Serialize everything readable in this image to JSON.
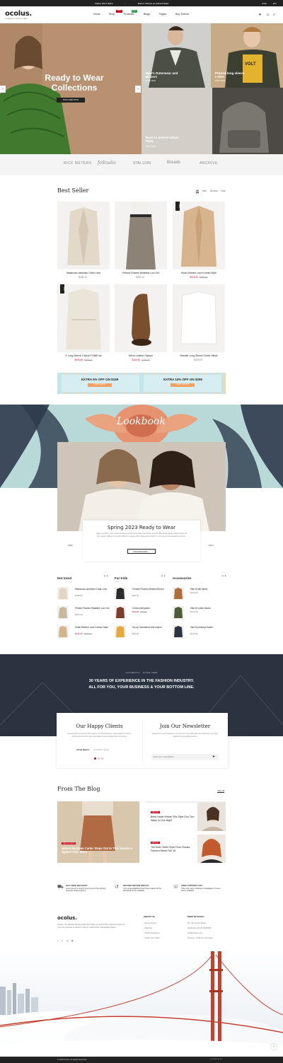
{
  "topbar": {
    "msg1": "FREE RETURNS",
    "msg2": "BEST PRICE GUARANTEED",
    "lang": "USD",
    "lang2": "EN"
  },
  "header": {
    "logo": "ocolus.",
    "tagline": "ECOMMERCE · SHOPIFY THEME",
    "nav": [
      "Home",
      "Shop",
      "Products",
      "Blogs",
      "Pages",
      "Buy Theme!"
    ],
    "badges": {
      "shop": "SALE",
      "products": "HOT"
    },
    "cart_count": "0"
  },
  "hero": {
    "title_line1": "Ready to Wear",
    "title_line2": "Collections",
    "cta": "DISCOVER NOW",
    "block_outerwear": "Men's Outerwear and Blazers",
    "block_outerwear_cta": "SHOP NOW",
    "block_tshirt": "Printed long sleeve t-shirt",
    "block_tshirt_cta": "SHOP NOW",
    "block_school": "Back to school Urban BGM",
    "block_school_cta": "SHOP NOW",
    "tshirt_print": "VOLT"
  },
  "brands": [
    "RICK METERS",
    "foStudio",
    "STAL LION",
    "Breads",
    "ARCHIVE"
  ],
  "best_seller": {
    "title": "Best Seller",
    "filters": [
      "All",
      "Men",
      "Women",
      "Kids"
    ],
    "products": [
      {
        "name": "Waistcoat Lambskin Collar Linin",
        "price": "$189.00",
        "old": "",
        "sale": false,
        "tag": ""
      },
      {
        "name": "Printed Flowers Waistline Low Girl",
        "price": "$254.10",
        "old": "",
        "sale": false,
        "tag": ""
      },
      {
        "name": "Khaki Women Lace Korean Style",
        "price": "$216.30",
        "old": "$199.40",
        "sale": true,
        "tag": "NEW"
      },
      {
        "name": "4' Long Sleeve V-Neck PL688 Hot",
        "price": "$205.45",
        "old": "$199.40",
        "sale": true,
        "tag": "NEW"
      },
      {
        "name": "Men's Leather Olympo",
        "price": "$120.30",
        "old": "$199.40",
        "sale": true,
        "tag": ""
      },
      {
        "name": "Sweater Long Sleeve Gothic Hthyle",
        "price": "$215.00",
        "old": "",
        "sale": false,
        "tag": ""
      }
    ]
  },
  "promo": {
    "left": "EXTRA 5% OFF ON $159",
    "left_cta": "CODE: SO5OFF",
    "right": "EXTRA 10% OFF ON $299",
    "right_cta": "CODE: SO10OFF"
  },
  "lookbook": {
    "script": "Lookbook",
    "title": "Spring 2023 Ready to Wear",
    "desc": "Utility, functions, and comfort are three of fashion's buzziest keywords, and Tory Alexander Wang is offering them all this season. Riffing on her fall's build for creative ethos, Wang has evolved 7+ core group of sweatshirts and knits.",
    "cta": "DISCOVER NOW →",
    "prev": "PREV",
    "next": "NEXT"
  },
  "lists": [
    {
      "title": "Hot trend",
      "items": [
        {
          "name": "Waistcoat Lambskin Collar Linin",
          "price": "$189.00",
          "old": "",
          "sale": false
        },
        {
          "name": "Printed Flowers Waistline Low Girl",
          "price": "$254.10",
          "old": "",
          "sale": false
        },
        {
          "name": "Khaki Women Lace Korean Style",
          "price": "$216.30",
          "old": "$199.40",
          "sale": true
        }
      ]
    },
    {
      "title": "For Kids",
      "items": [
        {
          "name": "Female Flowers Beaded Boxed",
          "price": "$45.00",
          "old": "",
          "sale": false
        },
        {
          "name": "Cotton twill jacket",
          "price": "$30.00",
          "old": "$32.00",
          "sale": true
        },
        {
          "name": "Zip-up Sweatshirt with stripes",
          "price": "$40.00",
          "old": "",
          "sale": false
        }
      ]
    },
    {
      "title": "Accessories",
      "items": [
        {
          "name": "Slim fit silk blazer",
          "price": "$110.00",
          "old": "",
          "sale": false
        },
        {
          "name": "Slim fit cotton blazer",
          "price": "$120.00",
          "old": "",
          "sale": false
        },
        {
          "name": "Slim fit pinstripe blazer",
          "price": "$130.00",
          "old": "",
          "sale": false
        }
      ]
    }
  ],
  "dark_band": {
    "eyebrow": "AUTHENTIC · SINCE 1988",
    "line1": "30 YEARS OF EXPERIENCE IN THE FASHION INDUSTRY.",
    "line2": "ALL FOR YOU, YOUR BUSINESS & YOUR BOTTOM LINE."
  },
  "clients": {
    "title": "Our Happy Clients",
    "quote": "Amazing theme and top class support. As PR & beginner, I was helped me above and beyond and was more than patient move forward with your theme.",
    "author": "Annie Quinn",
    "role": "Co-founder / Sanna"
  },
  "newsletter": {
    "title": "Join Our Newsletter",
    "desc": "Subscribe to our newsletters now and stay up-to-date with new collections, the latest lookbooks and exclusive offers.",
    "placeholder": "Enter your email address"
  },
  "blog": {
    "title": "From The Blog",
    "view_all": "View all",
    "featured_tag": "FASHION NEWS",
    "featured_title": "Helena Bonham Carter Steps Out In This Season's Ugliest-Chic Shoe",
    "post1_tag": "FASHION",
    "post1_title": "Bella Hadid Wears '00s-Style Dior Two Ways In One Night",
    "post2_tag": "FASHION",
    "post2_title": "The Best Street Style From Russia Fashion Week Fall '18"
  },
  "features": [
    {
      "title": "GET FREE DELIVERY",
      "text": "Lorem ipsum is simply dummy text of the printing and type setting industry."
    },
    {
      "title": "RETURN WITHIN 30DAYS",
      "text": "It is a long established fact that a reader will be distracted by the readable."
    },
    {
      "title": "FREE SUPPORT 24/7",
      "text": "There are many variations of passages of Lorem Ipsum available."
    }
  ],
  "footer": {
    "logo": "ocolus.",
    "about": "Ocolus - the ultimate Shopify Arabic Rstr helps you sell anything the best choice for your new personal or client's e-shop or multi vendor marketplace project.",
    "about_title": "ABOUT US",
    "about_links": [
      "About Ocolus",
      "Sitemap",
      "Trade Assurance",
      "Track Your Order"
    ],
    "contact_title": "KEEP IN TOUCH",
    "contact_lines": [
      "No. 131 South Plaza",
      "California +00 23 2545 800",
      "info@ocolus.com",
      "8:00 am - 6:00 pm, everyday"
    ],
    "copyright": "© 2020 Ocolus. All Rights Reserved.",
    "payments": "VISA PAYPAL MC"
  },
  "colors": {
    "accent": "#d0021b",
    "dark": "#2b3341",
    "sage": "#c9b99a"
  }
}
